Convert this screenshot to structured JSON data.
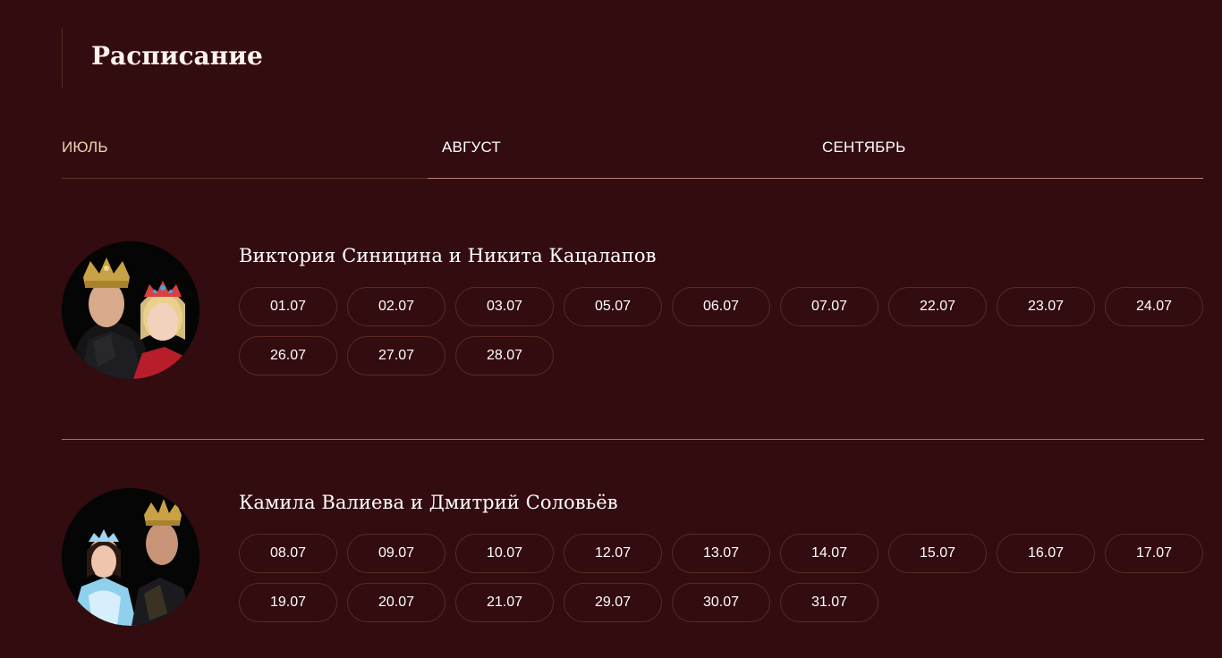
{
  "header": {
    "title": "Расписание"
  },
  "tabs": [
    {
      "label": "ИЮЛЬ",
      "active": true
    },
    {
      "label": "АВГУСТ",
      "active": false
    },
    {
      "label": "СЕНТЯБРЬ",
      "active": false
    }
  ],
  "performers": [
    {
      "name": "Виктория Синицина и Никита Кацалапов",
      "dates": [
        "01.07",
        "02.07",
        "03.07",
        "05.07",
        "06.07",
        "07.07",
        "22.07",
        "23.07",
        "24.07",
        "26.07",
        "27.07",
        "28.07"
      ]
    },
    {
      "name": "Камила Валиева и Дмитрий Соловьёв",
      "dates": [
        "08.07",
        "09.07",
        "10.07",
        "12.07",
        "13.07",
        "14.07",
        "15.07",
        "16.07",
        "17.07",
        "19.07",
        "20.07",
        "21.07",
        "29.07",
        "30.07",
        "31.07"
      ]
    }
  ],
  "colors": {
    "background": "#330c10",
    "active_tab": "#f0d2b0",
    "pill_border": "#5a2a22",
    "divider": "#a56d66"
  }
}
